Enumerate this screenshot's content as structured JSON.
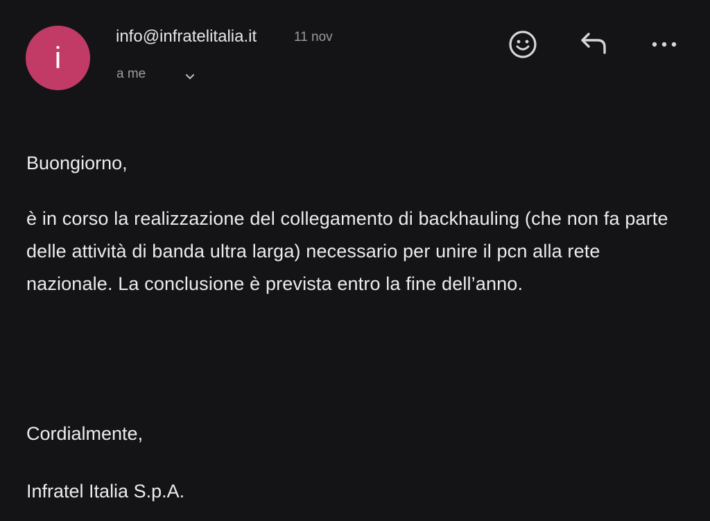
{
  "colors": {
    "background": "#141416",
    "avatar_bg": "#c23b67",
    "primary_text": "#e8e8ea",
    "secondary_text": "#9a9aa0",
    "icon": "#d6d6d8"
  },
  "header": {
    "avatar_letter": "i",
    "sender": "info@infratelitalia.it",
    "date": "11 nov",
    "recipient": "a me",
    "icons": {
      "expand": "chevron-down-icon",
      "reaction": "emoji-icon",
      "reply": "reply-icon",
      "more": "more-horizontal-icon"
    }
  },
  "message": {
    "greeting": "Buongiorno,",
    "paragraph": "è in corso la realizzazione del collegamento di backhauling (che non fa parte delle attività di banda ultra larga) necessario per unire il pcn alla rete nazionale. La conclusione è prevista entro la fine dell’anno.",
    "closing": "Cordialmente,",
    "signature": "Infratel Italia S.p.A."
  }
}
